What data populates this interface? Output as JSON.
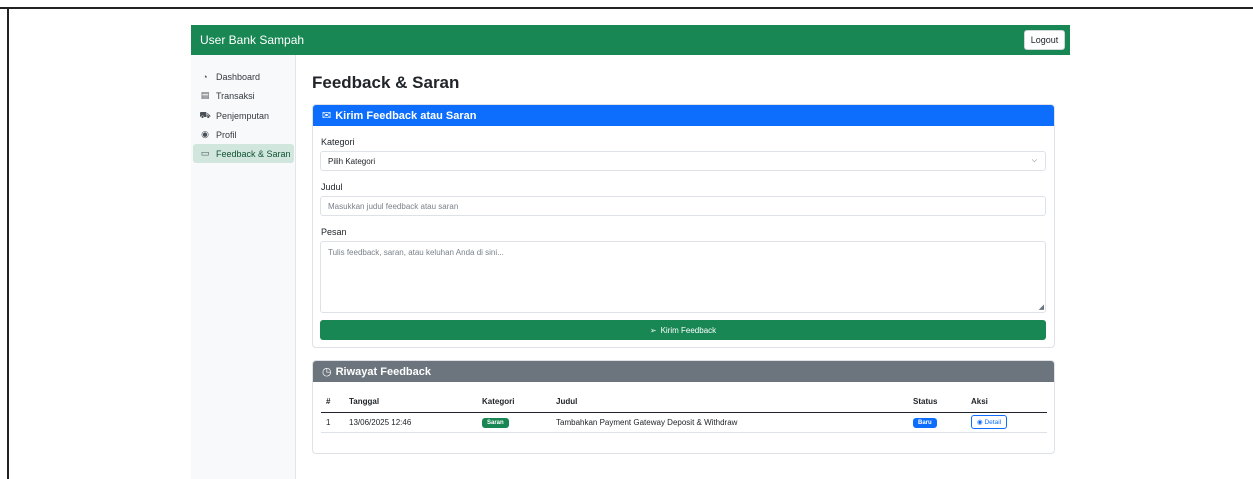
{
  "navbar": {
    "brand": "User Bank Sampah",
    "logout_label": "Logout"
  },
  "sidebar": {
    "items": [
      {
        "label": "Dashboard",
        "icon": "speedometer-icon",
        "glyph": "◔"
      },
      {
        "label": "Transaksi",
        "icon": "receipt-icon",
        "glyph": "▤"
      },
      {
        "label": "Penjemputan",
        "icon": "truck-icon",
        "glyph": "⛟"
      },
      {
        "label": "Profil",
        "icon": "person-circle-icon",
        "glyph": "◉"
      },
      {
        "label": "Feedback & Saran",
        "icon": "chat-icon",
        "glyph": "▭"
      }
    ]
  },
  "page": {
    "title": "Feedback & Saran"
  },
  "form": {
    "header": "Kirim Feedback atau Saran",
    "header_glyph": "✉",
    "kategori_label": "Kategori",
    "kategori_value": "Pilih Kategori",
    "judul_label": "Judul",
    "judul_placeholder": "Masukkan judul feedback atau saran",
    "pesan_label": "Pesan",
    "pesan_placeholder": "Tulis feedback, saran, atau keluhan Anda di sini...",
    "submit_label": "Kirim Feedback",
    "submit_glyph": "➢"
  },
  "history": {
    "header": "Riwayat Feedback",
    "header_glyph": "◷",
    "columns": [
      "#",
      "Tanggal",
      "Kategori",
      "Judul",
      "Status",
      "Aksi"
    ],
    "rows": [
      {
        "no": "1",
        "tanggal": "13/06/2025 12:46",
        "kategori": "Saran",
        "judul": "Tambahkan Payment Gateway Deposit & Withdraw",
        "status": "Baru",
        "aksi": "Detail",
        "aksi_glyph": "◉"
      }
    ]
  },
  "colors": {
    "primary": "#0d6efd",
    "success": "#198754",
    "secondary": "#6c757d",
    "active_bg": "#d1e7dd"
  }
}
